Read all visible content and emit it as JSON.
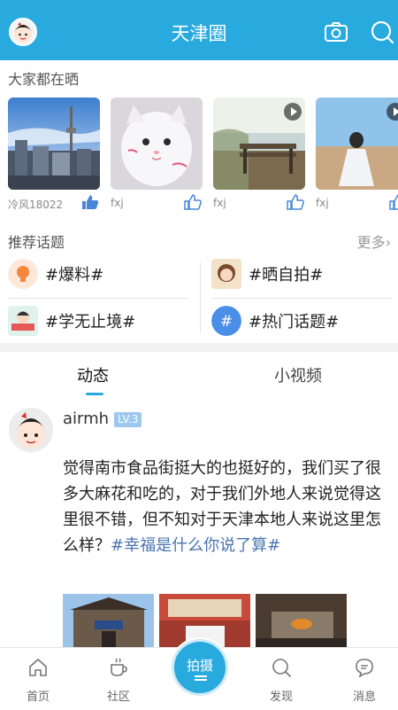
{
  "header": {
    "title": "天津圈"
  },
  "sharing": {
    "title": "大家都在晒",
    "items": [
      {
        "user": "冷风18022",
        "video": false
      },
      {
        "user": "fxj",
        "video": false
      },
      {
        "user": "fxj",
        "video": true
      },
      {
        "user": "fxj",
        "video": true
      }
    ]
  },
  "topics": {
    "title": "推荐话题",
    "more": "更多",
    "items": [
      {
        "label": "#爆料#"
      },
      {
        "label": "#晒自拍#"
      },
      {
        "label": "#学无止境#"
      },
      {
        "label": "#热门话题#"
      }
    ]
  },
  "tabs": [
    {
      "label": "动态",
      "active": true
    },
    {
      "label": "小视频",
      "active": false
    }
  ],
  "post": {
    "user": "airmh",
    "level": "LV.3",
    "text": "觉得南市食品街挺大的也挺好的，我们买了很多大麻花和吃的，对于我们外地人来说觉得这里很不错，但不知对于天津本地人来说这里怎么样？",
    "tag": "#幸福是什么你说了算#"
  },
  "nav": {
    "items": [
      {
        "label": "首页"
      },
      {
        "label": "社区"
      },
      {
        "label": "拍摄"
      },
      {
        "label": "发现"
      },
      {
        "label": "消息"
      }
    ]
  },
  "colors": {
    "accent": "#29aadf",
    "tag": "#4a74b0",
    "level_badge": "#9cc8f0"
  }
}
